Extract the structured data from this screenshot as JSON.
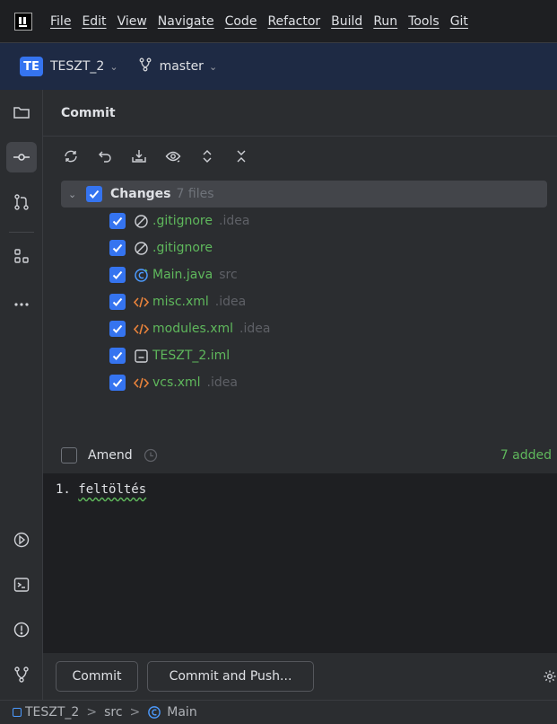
{
  "menu": [
    "File",
    "Edit",
    "View",
    "Navigate",
    "Code",
    "Refactor",
    "Build",
    "Run",
    "Tools",
    "Git"
  ],
  "project": {
    "badge": "TE",
    "name": "TESZT_2",
    "branch": "master"
  },
  "panel": {
    "title": "Commit"
  },
  "changes": {
    "label": "Changes",
    "count": "7 files",
    "files": [
      {
        "name": ".gitignore",
        "dir": ".idea",
        "icon": "ignore-icon"
      },
      {
        "name": ".gitignore",
        "dir": "",
        "icon": "ignore-icon"
      },
      {
        "name": "Main.java",
        "dir": "src",
        "icon": "java-class-icon"
      },
      {
        "name": "misc.xml",
        "dir": ".idea",
        "icon": "xml-icon"
      },
      {
        "name": "modules.xml",
        "dir": ".idea",
        "icon": "xml-icon"
      },
      {
        "name": "TESZT_2.iml",
        "dir": "",
        "icon": "module-file-icon"
      },
      {
        "name": "vcs.xml",
        "dir": ".idea",
        "icon": "xml-icon"
      }
    ]
  },
  "amend": {
    "label": "Amend",
    "added": "7 added"
  },
  "message": {
    "prefix": "1. ",
    "word": "feltöltés"
  },
  "buttons": {
    "commit": "Commit",
    "commit_push": "Commit and Push..."
  },
  "breadcrumb": [
    "TESZT_2",
    "src",
    "Main"
  ],
  "colors": {
    "accent": "#3574f0",
    "added": "#5fb85c",
    "xml": "#e8823b"
  }
}
